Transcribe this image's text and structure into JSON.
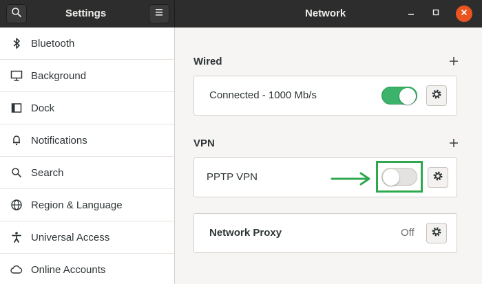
{
  "header": {
    "settings_title": "Settings",
    "panel_title": "Network",
    "search_icon": "search-icon",
    "menu_icon": "hamburger-menu-icon",
    "window_controls": [
      "minimize-icon",
      "maximize-icon",
      "close-icon"
    ],
    "close_color": "#e95420"
  },
  "sidebar": {
    "items": [
      {
        "label": "Bluetooth",
        "icon": "bluetooth-icon"
      },
      {
        "label": "Background",
        "icon": "monitor-icon"
      },
      {
        "label": "Dock",
        "icon": "dock-icon"
      },
      {
        "label": "Notifications",
        "icon": "bell-icon"
      },
      {
        "label": "Search",
        "icon": "search-icon"
      },
      {
        "label": "Region & Language",
        "icon": "globe-icon"
      },
      {
        "label": "Universal Access",
        "icon": "accessibility-icon"
      },
      {
        "label": "Online Accounts",
        "icon": "cloud-icon"
      }
    ]
  },
  "main": {
    "wired": {
      "title": "Wired",
      "connection_label": "Connected - 1000 Mb/s",
      "switch_on": true,
      "switch_color": "#3bb36a"
    },
    "vpn": {
      "title": "VPN",
      "connection_label": "PPTP VPN",
      "switch_on": false,
      "highlight_color": "#2fa84f"
    },
    "proxy": {
      "label": "Network Proxy",
      "status": "Off"
    }
  }
}
